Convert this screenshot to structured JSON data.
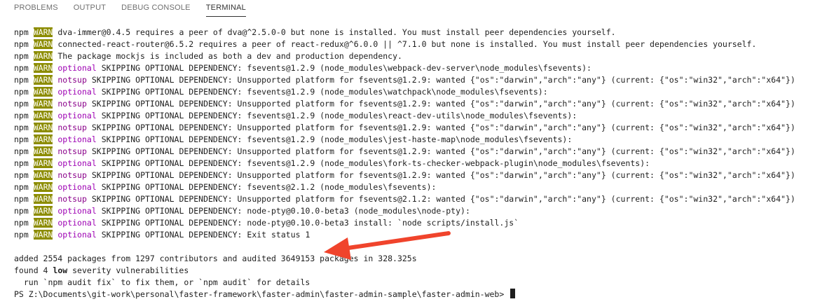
{
  "tabs": [
    {
      "label": "PROBLEMS"
    },
    {
      "label": "OUTPUT"
    },
    {
      "label": "DEBUG CONSOLE"
    },
    {
      "label": "TERMINAL",
      "active": true
    }
  ],
  "terminal": {
    "warn_lines": [
      {
        "prefix": "npm",
        "badge": "WARN",
        "tag": "",
        "text": "dva-immer@0.4.5 requires a peer of dva@^2.5.0-0 but none is installed. You must install peer dependencies yourself."
      },
      {
        "prefix": "npm",
        "badge": "WARN",
        "tag": "",
        "text": "connected-react-router@6.5.2 requires a peer of react-redux@^6.0.0 || ^7.1.0 but none is installed. You must install peer dependencies yourself."
      },
      {
        "prefix": "npm",
        "badge": "WARN",
        "tag": "",
        "text": "The package mockjs is included as both a dev and production dependency."
      },
      {
        "prefix": "npm",
        "badge": "WARN",
        "tag": "optional",
        "text": "SKIPPING OPTIONAL DEPENDENCY: fsevents@1.2.9 (node_modules\\webpack-dev-server\\node_modules\\fsevents):"
      },
      {
        "prefix": "npm",
        "badge": "WARN",
        "tag": "notsup",
        "text": "SKIPPING OPTIONAL DEPENDENCY: Unsupported platform for fsevents@1.2.9: wanted {\"os\":\"darwin\",\"arch\":\"any\"} (current: {\"os\":\"win32\",\"arch\":\"x64\"})"
      },
      {
        "prefix": "npm",
        "badge": "WARN",
        "tag": "optional",
        "text": "SKIPPING OPTIONAL DEPENDENCY: fsevents@1.2.9 (node_modules\\watchpack\\node_modules\\fsevents):"
      },
      {
        "prefix": "npm",
        "badge": "WARN",
        "tag": "notsup",
        "text": "SKIPPING OPTIONAL DEPENDENCY: Unsupported platform for fsevents@1.2.9: wanted {\"os\":\"darwin\",\"arch\":\"any\"} (current: {\"os\":\"win32\",\"arch\":\"x64\"})"
      },
      {
        "prefix": "npm",
        "badge": "WARN",
        "tag": "optional",
        "text": "SKIPPING OPTIONAL DEPENDENCY: fsevents@1.2.9 (node_modules\\react-dev-utils\\node_modules\\fsevents):"
      },
      {
        "prefix": "npm",
        "badge": "WARN",
        "tag": "notsup",
        "text": "SKIPPING OPTIONAL DEPENDENCY: Unsupported platform for fsevents@1.2.9: wanted {\"os\":\"darwin\",\"arch\":\"any\"} (current: {\"os\":\"win32\",\"arch\":\"x64\"})"
      },
      {
        "prefix": "npm",
        "badge": "WARN",
        "tag": "optional",
        "text": "SKIPPING OPTIONAL DEPENDENCY: fsevents@1.2.9 (node_modules\\jest-haste-map\\node_modules\\fsevents):"
      },
      {
        "prefix": "npm",
        "badge": "WARN",
        "tag": "notsup",
        "text": "SKIPPING OPTIONAL DEPENDENCY: Unsupported platform for fsevents@1.2.9: wanted {\"os\":\"darwin\",\"arch\":\"any\"} (current: {\"os\":\"win32\",\"arch\":\"x64\"})"
      },
      {
        "prefix": "npm",
        "badge": "WARN",
        "tag": "optional",
        "text": "SKIPPING OPTIONAL DEPENDENCY: fsevents@1.2.9 (node_modules\\fork-ts-checker-webpack-plugin\\node_modules\\fsevents):"
      },
      {
        "prefix": "npm",
        "badge": "WARN",
        "tag": "notsup",
        "text": "SKIPPING OPTIONAL DEPENDENCY: Unsupported platform for fsevents@1.2.9: wanted {\"os\":\"darwin\",\"arch\":\"any\"} (current: {\"os\":\"win32\",\"arch\":\"x64\"})"
      },
      {
        "prefix": "npm",
        "badge": "WARN",
        "tag": "optional",
        "text": "SKIPPING OPTIONAL DEPENDENCY: fsevents@2.1.2 (node_modules\\fsevents):"
      },
      {
        "prefix": "npm",
        "badge": "WARN",
        "tag": "notsup",
        "text": "SKIPPING OPTIONAL DEPENDENCY: Unsupported platform for fsevents@2.1.2: wanted {\"os\":\"darwin\",\"arch\":\"any\"} (current: {\"os\":\"win32\",\"arch\":\"x64\"})"
      },
      {
        "prefix": "npm",
        "badge": "WARN",
        "tag": "optional",
        "text": "SKIPPING OPTIONAL DEPENDENCY: node-pty@0.10.0-beta3 (node_modules\\node-pty):"
      },
      {
        "prefix": "npm",
        "badge": "WARN",
        "tag": "optional",
        "text": "SKIPPING OPTIONAL DEPENDENCY: node-pty@0.10.0-beta3 install: `node scripts/install.js`"
      },
      {
        "prefix": "npm",
        "badge": "WARN",
        "tag": "optional",
        "text": "SKIPPING OPTIONAL DEPENDENCY: Exit status 1"
      }
    ],
    "summary_added": "added 2554 packages from 1297 contributors and audited 3649153 packages in 328.325s",
    "found_before": "found 4 ",
    "found_severity": "low",
    "found_after": " severity vulnerabilities",
    "run_hint": "  run `npm audit fix` to fix them, or `npm audit` for details",
    "prompt": "PS Z:\\Documents\\git-work\\personal\\faster-framework\\faster-admin\\faster-admin-sample\\faster-admin-web> "
  },
  "colors": {
    "warn_badge_bg": "#8c8c00",
    "optional_tag": "#9d00b3",
    "arrow": "#f0442c"
  }
}
